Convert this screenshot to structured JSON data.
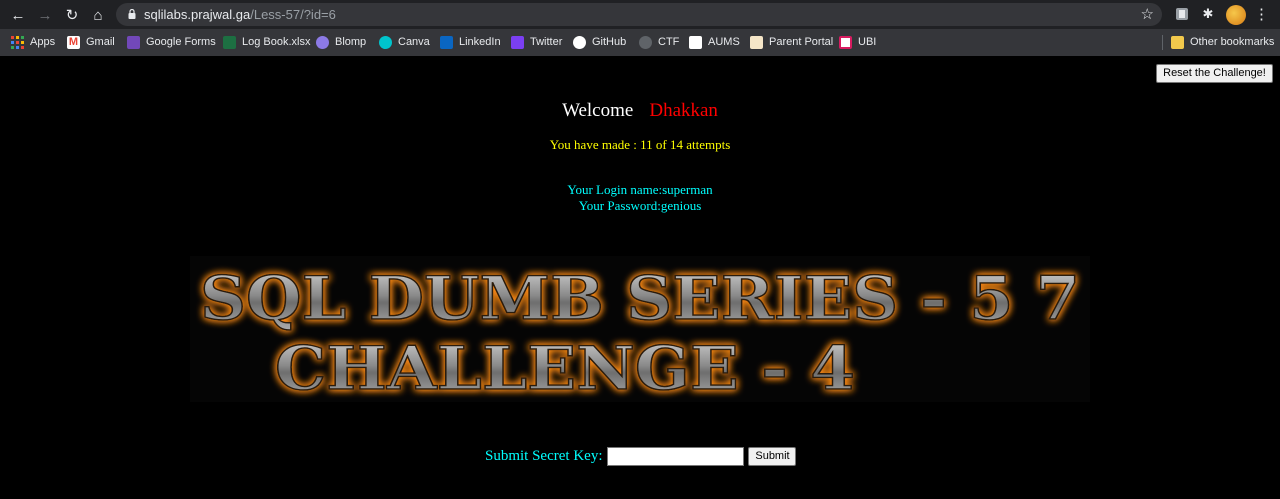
{
  "browser": {
    "url_host": "sqlilabs.prajwal.ga",
    "url_path": "/Less-57/?id=6",
    "bookmarks": [
      {
        "label": "Apps",
        "icon": "apps-grid-icon",
        "color": "#ea4335"
      },
      {
        "label": "Gmail",
        "icon": "gmail-icon",
        "color": "#ea4335"
      },
      {
        "label": "Google Forms",
        "icon": "google-forms-icon",
        "color": "#7248b9"
      },
      {
        "label": "Log Book.xlsx",
        "icon": "excel-icon",
        "color": "#1d6f42"
      },
      {
        "label": "Blomp",
        "icon": "blomp-icon",
        "color": "#8c7ae6"
      },
      {
        "label": "Canva",
        "icon": "canva-icon",
        "color": "#00c4cc"
      },
      {
        "label": "LinkedIn",
        "icon": "linkedin-icon",
        "color": "#0a66c2"
      },
      {
        "label": "Twitter",
        "icon": "twitter-icon",
        "color": "#7b3ff2"
      },
      {
        "label": "GitHub",
        "icon": "github-icon",
        "color": "#ffffff"
      },
      {
        "label": "CTF",
        "icon": "ctf-icon",
        "color": "#e8eaed"
      },
      {
        "label": "AUMS",
        "icon": "aums-icon",
        "color": "#ffffff"
      },
      {
        "label": "Parent Portal",
        "icon": "parent-portal-icon",
        "color": "#f5e6c8"
      },
      {
        "label": "UBI",
        "icon": "ubi-icon",
        "color": "#d81b60"
      }
    ],
    "other_bookmarks": "Other bookmarks"
  },
  "page": {
    "reset_label": "Reset the Challenge!",
    "welcome_label": "Welcome",
    "welcome_name": "Dhakkan",
    "attempts_text": "You have made : 11 of 14 attempts",
    "login_name": "Your Login name:superman",
    "password": "Your Password:genious",
    "banner_line1": "SQL DUMB SERIES - 5 7",
    "banner_line2": "CHALLENGE - 4",
    "submit_label": "Submit Secret Key:",
    "key_value": "",
    "submit_button": "Submit"
  },
  "colors": {
    "welcome_name": "#ff0000",
    "attempts": "#ffff00",
    "info": "#00ffff",
    "banner_glow": "#ff8c1a"
  }
}
